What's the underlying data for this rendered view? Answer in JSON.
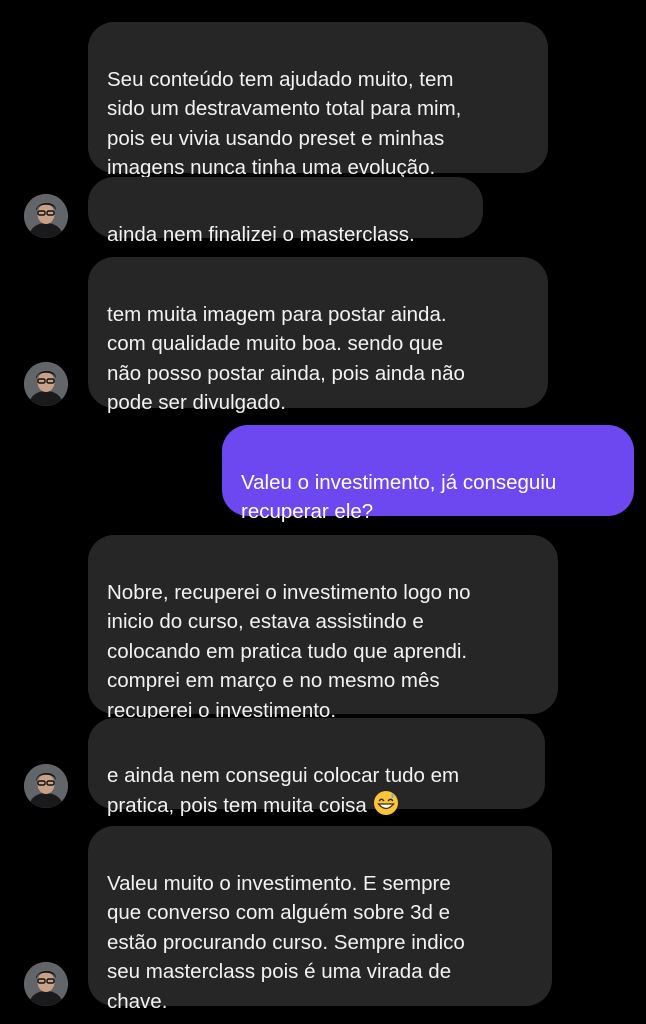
{
  "chat": {
    "contact_avatar": "user-avatar-photo",
    "colors": {
      "background": "#000000",
      "incoming_bubble": "#262626",
      "outgoing_bubble": "#6d47f0",
      "text": "#f2f2f2"
    },
    "messages": [
      {
        "from": "contact",
        "text": "Seu conteúdo tem ajudado muito, tem\nsido um destravamento total para mim,\npois eu vivia usando preset e minhas\nimagens nunca tinha uma evolução."
      },
      {
        "from": "contact",
        "text": "ainda nem finalizei o masterclass."
      },
      {
        "from": "contact",
        "text": "tem muita imagem para postar ainda.\ncom qualidade muito boa. sendo que\nnão posso postar ainda, pois ainda não\npode ser divulgado."
      },
      {
        "from": "me",
        "text": "Valeu o investimento, já conseguiu\nrecuperar ele?"
      },
      {
        "from": "contact",
        "text": "Nobre, recuperei o investimento logo no\ninicio do curso, estava assistindo e\ncolocando em pratica tudo que aprendi.\ncomprei em março e no mesmo mês\nrecuperei o investimento."
      },
      {
        "from": "contact",
        "text": "e ainda nem consegui colocar tudo em\npratica, pois tem muita coisa",
        "emoji": "grinning-sweat-emoji"
      },
      {
        "from": "contact",
        "text": "Valeu muito o investimento. E sempre\nque converso com alguém sobre 3d e\nestão procurando curso. Sempre indico\nseu masterclass pois é uma virada de\nchave."
      }
    ]
  }
}
